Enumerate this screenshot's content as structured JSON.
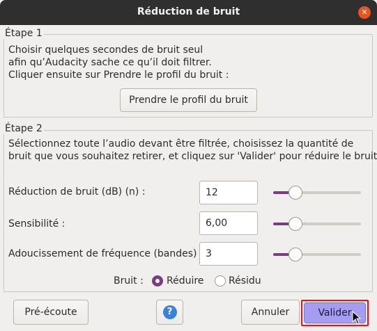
{
  "window": {
    "title": "Réduction de bruit",
    "close_icon": "close-icon"
  },
  "step1": {
    "title": "Étape 1",
    "line1": "Choisir quelques secondes de bruit seul",
    "line2": "afin qu’Audacity sache ce qu’il doit filtrer.",
    "line3": "Cliquer ensuite sur Prendre le profil du bruit :",
    "profile_button": "Prendre le profil du bruit"
  },
  "step2": {
    "title": "Étape 2",
    "line1": "Sélectionnez toute l’audio devant être filtrée, choisissez la quantité de",
    "line2": "bruit que vous souhaitez retirer, et cliquez sur 'Valider' pour réduire le bruit.",
    "params": [
      {
        "label": "Réduction de bruit (dB) (n) :",
        "value": "12",
        "slider_fraction": 0.26
      },
      {
        "label": "Sensibilité :",
        "value": "6,00",
        "slider_fraction": 0.26
      },
      {
        "label": "Adoucissement de fréquence (bandes) :",
        "value": "3",
        "slider_fraction": 0.26
      }
    ],
    "noise_label": "Bruit :",
    "noise_options": [
      {
        "label": "Réduire",
        "checked": true
      },
      {
        "label": "Résidu",
        "checked": false
      }
    ]
  },
  "buttons": {
    "preview": "Pré-écoute",
    "help_icon": "help-icon",
    "cancel": "Annuler",
    "validate": "Valider"
  },
  "colors": {
    "accent": "#7a3d83",
    "close": "#e95420",
    "help": "#3b82d8",
    "highlight": "#e4151c",
    "validate_bg": "#a69cf0"
  }
}
